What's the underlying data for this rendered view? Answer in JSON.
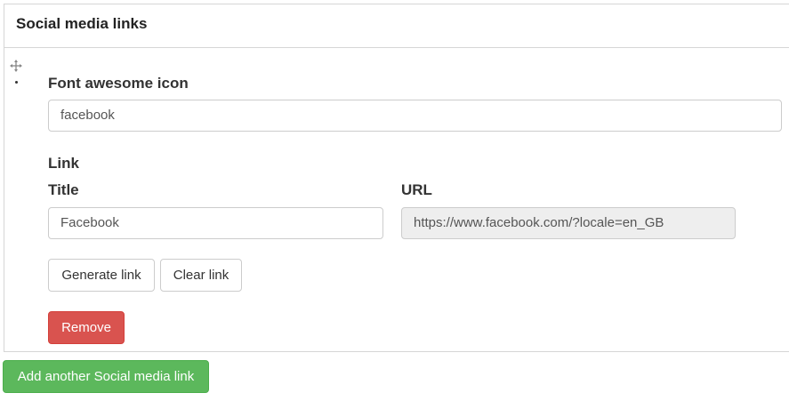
{
  "panel": {
    "title": "Social media links"
  },
  "item": {
    "icon_label": "Font awesome icon",
    "icon_value": "facebook",
    "link_heading": "Link",
    "title_label": "Title",
    "title_value": "Facebook",
    "url_label": "URL",
    "url_value": "https://www.facebook.com/?locale=en_GB",
    "generate_label": "Generate link",
    "clear_label": "Clear link",
    "remove_label": "Remove"
  },
  "add_button_label": "Add another Social media link",
  "colors": {
    "danger": "#d9534f",
    "success": "#5cb85c",
    "readonly_bg": "#eeeeee"
  }
}
